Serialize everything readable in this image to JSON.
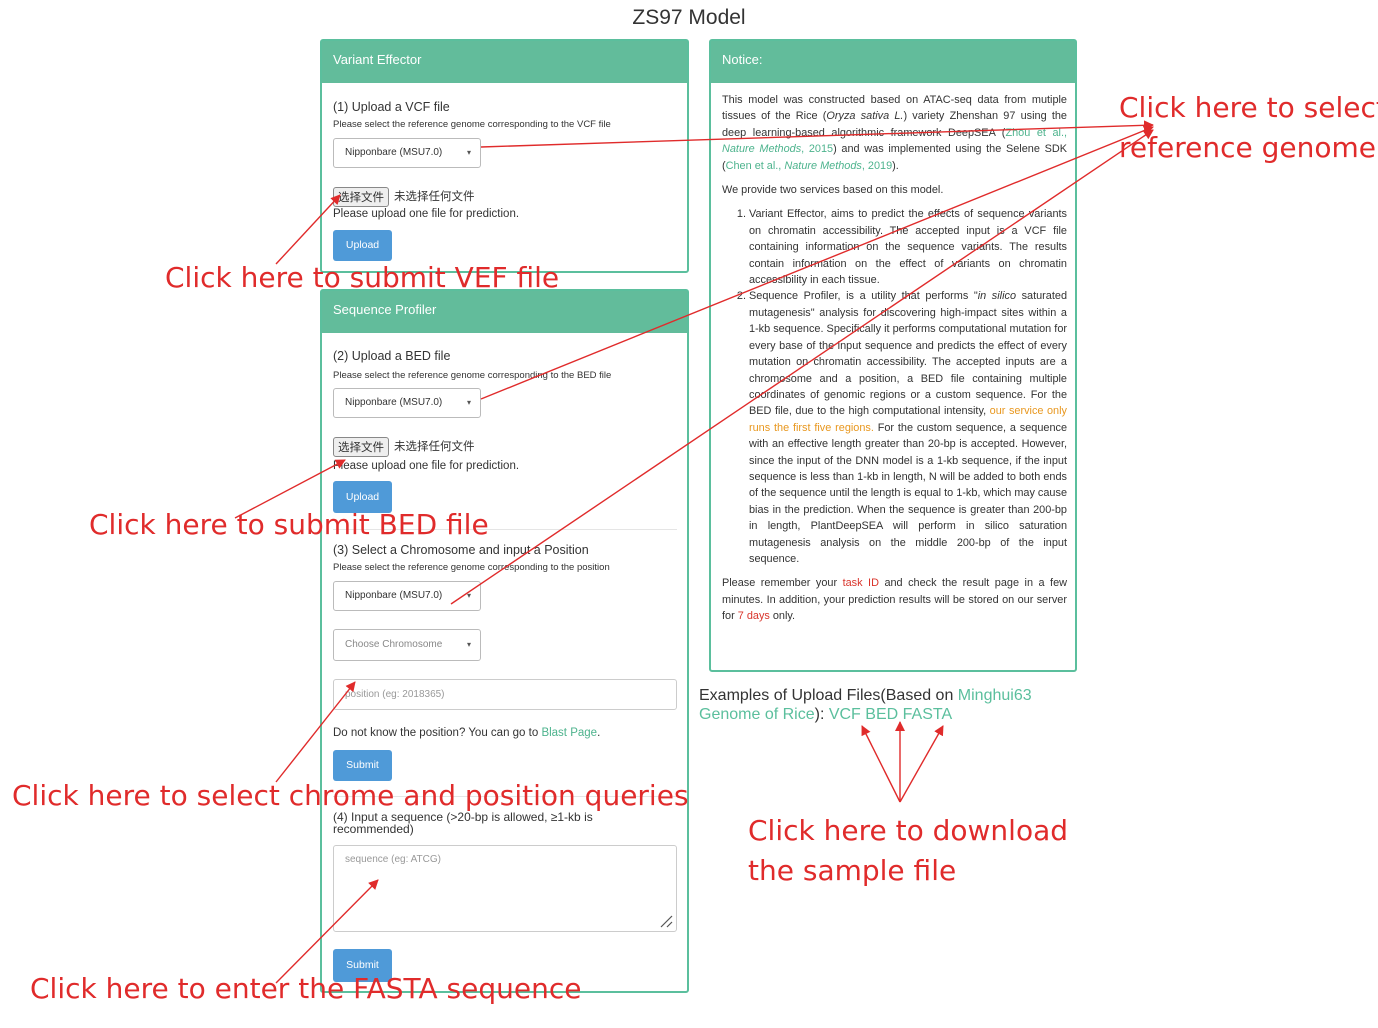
{
  "page": {
    "title": "ZS97 Model"
  },
  "variant_effector": {
    "header": "Variant Effector",
    "step_label": "(1) Upload a VCF file",
    "select_hint": "Please select the reference genome corresponding to the VCF file",
    "genome_select": "Nipponbare (MSU7.0)",
    "file_button": "选择文件",
    "file_status": "未选择任何文件",
    "upload_hint": "Please upload one file for prediction.",
    "upload_button": "Upload"
  },
  "sequence_profiler": {
    "header": "Sequence Profiler",
    "bed": {
      "step_label": "(2) Upload a BED file",
      "select_hint": "Please select the reference genome corresponding to the BED file",
      "genome_select": "Nipponbare (MSU7.0)",
      "file_button": "选择文件",
      "file_status": "未选择任何文件",
      "upload_hint": "Please upload one file for prediction.",
      "upload_button": "Upload"
    },
    "position": {
      "step_label": "(3) Select a Chromosome and input a Position",
      "select_hint": "Please select the reference genome corresponding to the position",
      "genome_select": "Nipponbare (MSU7.0)",
      "chromosome_placeholder": "Choose Chromosome",
      "position_placeholder": "position (eg: 2018365)",
      "blast_prefix": "Do not know the position? You can go to ",
      "blast_link": "Blast Page",
      "blast_suffix": ".",
      "submit_button": "Submit"
    },
    "sequence": {
      "step_label": "(4) Input a sequence (>20-bp is allowed, ≥1-kb is recommended)",
      "placeholder": "sequence (eg: ATCG)",
      "submit_button": "Submit"
    }
  },
  "notice": {
    "header": "Notice:",
    "intro": {
      "t1": "This model was constructed based on ATAC-seq data from mutiple tissues of the Rice (",
      "i1": "Oryza sativa L.",
      "t2": ") variety Zhenshan 97 using the deep learning-based algorithmic framework DeepSEA (",
      "ref1_authors": "Zhou et al., ",
      "ref1_journal": "Nature Methods",
      "ref1_year": ", 2015",
      "t3": ") and was implemented using the Selene SDK (",
      "ref2_authors": "Chen et al., ",
      "ref2_journal": "Nature Methods",
      "ref2_year": ", 2019",
      "t4": ")."
    },
    "services_intro": "We provide two services based on this model.",
    "item1": "Variant Effector, aims to predict the effects of sequence variants on chromatin accessibility. The accepted input is a VCF file containing information on the sequence variants. The results contain information on the effect of variants on chromatin accessibility in each tissue.",
    "item2": {
      "t1": "Sequence Profiler, is a utility that performs \"",
      "i1": "in silico",
      "t2": " saturated mutagenesis\" analysis for discovering high-impact sites within a 1-kb sequence. Specifically it performs computational mutation for every base of the input sequence and predicts the effect of every mutation on chromatin accessibility. The accepted inputs are a chromosome and a position, a BED file containing multiple coordinates of genomic regions or a custom sequence. For the BED file, due to the high computational intensity, ",
      "highlight": "our service only runs the first five regions.",
      "t3": " For the custom sequence, a sequence with an effective length greater than 20-bp is accepted. However, since the input of the DNN model is a 1-kb sequence, if the input sequence is less than 1-kb in length, N will be added to both ends of the sequence until the length is equal to 1-kb, which may cause bias in the prediction. When the sequence is greater than 200-bp in length, PlantDeepSEA will perform in silico saturation mutagenesis analysis on the middle 200-bp of the input sequence."
    },
    "closing": {
      "t1": "Please remember your ",
      "task_id": "task ID",
      "t2": " and check the result page in a few minutes. In addition, your prediction results will be stored on our server for ",
      "days": "7 days",
      "t3": " only."
    }
  },
  "examples": {
    "prefix": "Examples of Upload Files(Based on ",
    "genome_link": "Minghui63 Genome of Rice",
    "middle": "): ",
    "vcf": "VCF",
    "bed": "BED",
    "fasta": "FASTA"
  },
  "annotations": {
    "select_genome_line1": "Click here to select",
    "select_genome_line2": "reference genome",
    "submit_vef": "Click here to submit VEF file",
    "submit_bed": "Click here to submit BED file",
    "chrom_position": "Click here to select chrome and position queries",
    "download_line1": "Click here to download",
    "download_line2": "the sample file",
    "fasta": "Click here to enter the FASTA sequence"
  },
  "colors": {
    "panel_header": "#62bc9b",
    "panel_border": "#5bbf9d",
    "button": "#4f9ad8",
    "link_green": "#4db38d",
    "highlight_orange": "#e8971e",
    "highlight_red": "#d9342b",
    "annotation_red": "#e02b2b"
  }
}
